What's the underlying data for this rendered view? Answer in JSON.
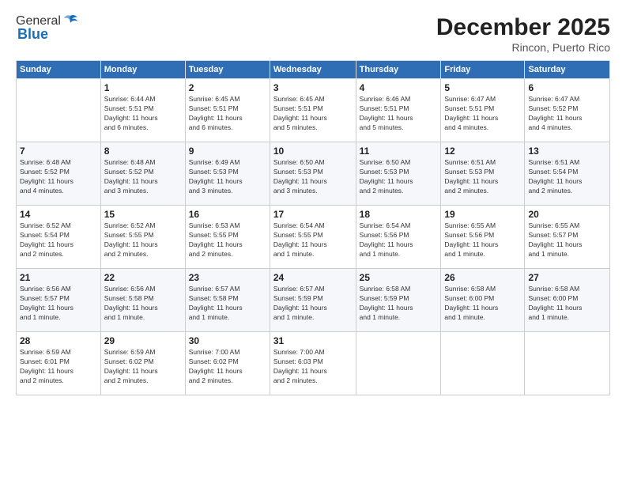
{
  "header": {
    "logo_general": "General",
    "logo_blue": "Blue",
    "month_year": "December 2025",
    "location": "Rincon, Puerto Rico"
  },
  "days_of_week": [
    "Sunday",
    "Monday",
    "Tuesday",
    "Wednesday",
    "Thursday",
    "Friday",
    "Saturday"
  ],
  "weeks": [
    [
      {
        "day": "",
        "info": ""
      },
      {
        "day": "1",
        "info": "Sunrise: 6:44 AM\nSunset: 5:51 PM\nDaylight: 11 hours\nand 6 minutes."
      },
      {
        "day": "2",
        "info": "Sunrise: 6:45 AM\nSunset: 5:51 PM\nDaylight: 11 hours\nand 6 minutes."
      },
      {
        "day": "3",
        "info": "Sunrise: 6:45 AM\nSunset: 5:51 PM\nDaylight: 11 hours\nand 5 minutes."
      },
      {
        "day": "4",
        "info": "Sunrise: 6:46 AM\nSunset: 5:51 PM\nDaylight: 11 hours\nand 5 minutes."
      },
      {
        "day": "5",
        "info": "Sunrise: 6:47 AM\nSunset: 5:51 PM\nDaylight: 11 hours\nand 4 minutes."
      },
      {
        "day": "6",
        "info": "Sunrise: 6:47 AM\nSunset: 5:52 PM\nDaylight: 11 hours\nand 4 minutes."
      }
    ],
    [
      {
        "day": "7",
        "info": "Sunrise: 6:48 AM\nSunset: 5:52 PM\nDaylight: 11 hours\nand 4 minutes."
      },
      {
        "day": "8",
        "info": "Sunrise: 6:48 AM\nSunset: 5:52 PM\nDaylight: 11 hours\nand 3 minutes."
      },
      {
        "day": "9",
        "info": "Sunrise: 6:49 AM\nSunset: 5:53 PM\nDaylight: 11 hours\nand 3 minutes."
      },
      {
        "day": "10",
        "info": "Sunrise: 6:50 AM\nSunset: 5:53 PM\nDaylight: 11 hours\nand 3 minutes."
      },
      {
        "day": "11",
        "info": "Sunrise: 6:50 AM\nSunset: 5:53 PM\nDaylight: 11 hours\nand 2 minutes."
      },
      {
        "day": "12",
        "info": "Sunrise: 6:51 AM\nSunset: 5:53 PM\nDaylight: 11 hours\nand 2 minutes."
      },
      {
        "day": "13",
        "info": "Sunrise: 6:51 AM\nSunset: 5:54 PM\nDaylight: 11 hours\nand 2 minutes."
      }
    ],
    [
      {
        "day": "14",
        "info": "Sunrise: 6:52 AM\nSunset: 5:54 PM\nDaylight: 11 hours\nand 2 minutes."
      },
      {
        "day": "15",
        "info": "Sunrise: 6:52 AM\nSunset: 5:55 PM\nDaylight: 11 hours\nand 2 minutes."
      },
      {
        "day": "16",
        "info": "Sunrise: 6:53 AM\nSunset: 5:55 PM\nDaylight: 11 hours\nand 2 minutes."
      },
      {
        "day": "17",
        "info": "Sunrise: 6:54 AM\nSunset: 5:55 PM\nDaylight: 11 hours\nand 1 minute."
      },
      {
        "day": "18",
        "info": "Sunrise: 6:54 AM\nSunset: 5:56 PM\nDaylight: 11 hours\nand 1 minute."
      },
      {
        "day": "19",
        "info": "Sunrise: 6:55 AM\nSunset: 5:56 PM\nDaylight: 11 hours\nand 1 minute."
      },
      {
        "day": "20",
        "info": "Sunrise: 6:55 AM\nSunset: 5:57 PM\nDaylight: 11 hours\nand 1 minute."
      }
    ],
    [
      {
        "day": "21",
        "info": "Sunrise: 6:56 AM\nSunset: 5:57 PM\nDaylight: 11 hours\nand 1 minute."
      },
      {
        "day": "22",
        "info": "Sunrise: 6:56 AM\nSunset: 5:58 PM\nDaylight: 11 hours\nand 1 minute."
      },
      {
        "day": "23",
        "info": "Sunrise: 6:57 AM\nSunset: 5:58 PM\nDaylight: 11 hours\nand 1 minute."
      },
      {
        "day": "24",
        "info": "Sunrise: 6:57 AM\nSunset: 5:59 PM\nDaylight: 11 hours\nand 1 minute."
      },
      {
        "day": "25",
        "info": "Sunrise: 6:58 AM\nSunset: 5:59 PM\nDaylight: 11 hours\nand 1 minute."
      },
      {
        "day": "26",
        "info": "Sunrise: 6:58 AM\nSunset: 6:00 PM\nDaylight: 11 hours\nand 1 minute."
      },
      {
        "day": "27",
        "info": "Sunrise: 6:58 AM\nSunset: 6:00 PM\nDaylight: 11 hours\nand 1 minute."
      }
    ],
    [
      {
        "day": "28",
        "info": "Sunrise: 6:59 AM\nSunset: 6:01 PM\nDaylight: 11 hours\nand 2 minutes."
      },
      {
        "day": "29",
        "info": "Sunrise: 6:59 AM\nSunset: 6:02 PM\nDaylight: 11 hours\nand 2 minutes."
      },
      {
        "day": "30",
        "info": "Sunrise: 7:00 AM\nSunset: 6:02 PM\nDaylight: 11 hours\nand 2 minutes."
      },
      {
        "day": "31",
        "info": "Sunrise: 7:00 AM\nSunset: 6:03 PM\nDaylight: 11 hours\nand 2 minutes."
      },
      {
        "day": "",
        "info": ""
      },
      {
        "day": "",
        "info": ""
      },
      {
        "day": "",
        "info": ""
      }
    ]
  ]
}
